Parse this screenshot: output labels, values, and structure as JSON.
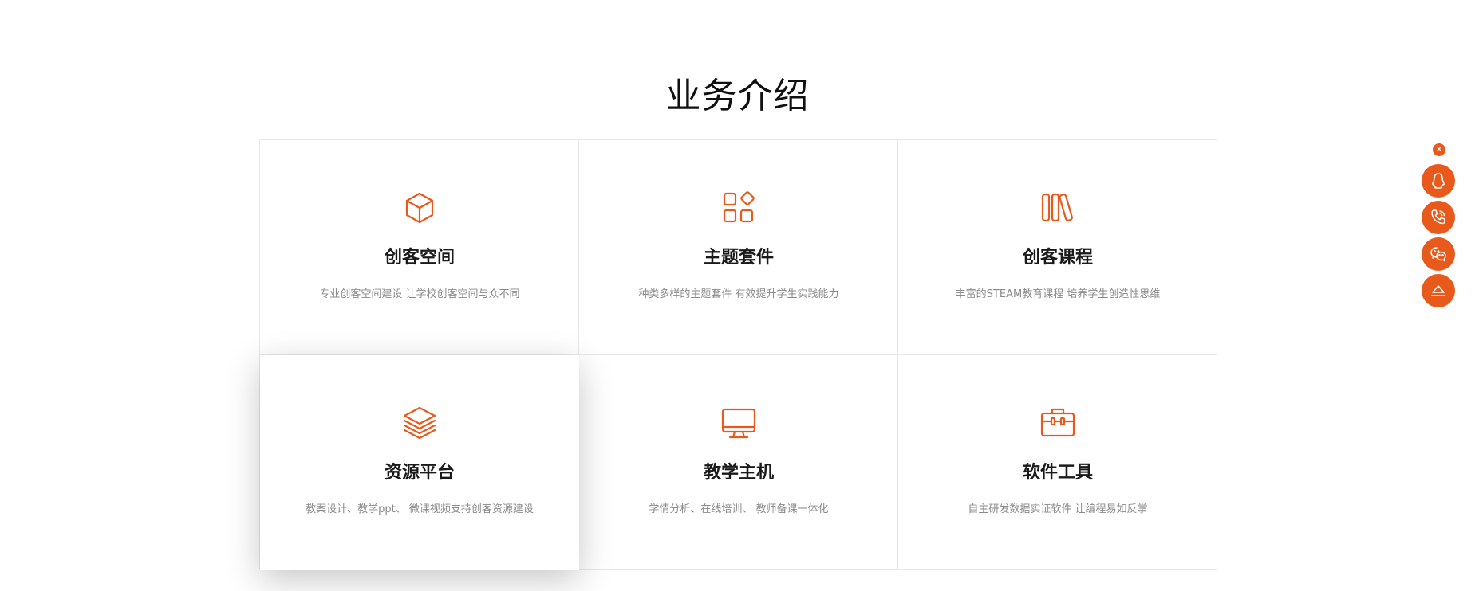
{
  "section": {
    "title": "业务介绍"
  },
  "accent_color": "#e85a1c",
  "cards": [
    {
      "icon": "cube-icon",
      "title": "创客空间",
      "desc": "专业创客空间建设 让学校创客空间与众不同"
    },
    {
      "icon": "apps-grid-icon",
      "title": "主题套件",
      "desc": "种类多样的主题套件 有效提升学生实践能力"
    },
    {
      "icon": "books-icon",
      "title": "创客课程",
      "desc": "丰富的STEAM教育课程 培养学生创造性思维"
    },
    {
      "icon": "layers-icon",
      "title": "资源平台",
      "desc": "教案设计、教学ppt、 微课视频支持创客资源建设"
    },
    {
      "icon": "monitor-icon",
      "title": "教学主机",
      "desc": "学情分析、在线培训、 教师备课一体化"
    },
    {
      "icon": "toolbox-icon",
      "title": "软件工具",
      "desc": "自主研发数据实证软件 让编程易如反掌"
    }
  ],
  "float_bar": {
    "close_icon": "close-icon",
    "buttons": [
      "qq-icon",
      "phone-icon",
      "wechat-icon",
      "back-to-top-icon"
    ]
  }
}
